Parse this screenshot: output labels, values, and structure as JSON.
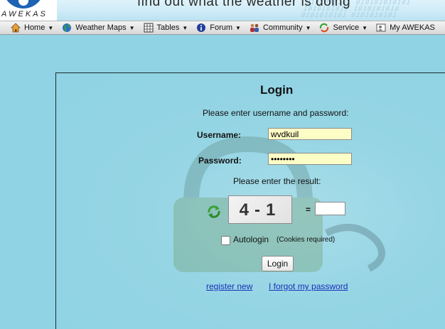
{
  "header": {
    "logo_text": "AWEKAS",
    "slogan": "find out what the weather is doing"
  },
  "nav": {
    "items": [
      {
        "label": "Home",
        "icon": "home-icon"
      },
      {
        "label": "Weather Maps",
        "icon": "globe-icon"
      },
      {
        "label": "Tables",
        "icon": "table-icon"
      },
      {
        "label": "Forum",
        "icon": "info-icon"
      },
      {
        "label": "Community",
        "icon": "people-icon"
      },
      {
        "label": "Service",
        "icon": "service-icon"
      },
      {
        "label": "My AWEKAS",
        "icon": "my-awekas-icon"
      }
    ]
  },
  "login": {
    "title": "Login",
    "instructions": "Please enter username and password:",
    "username_label": "Username:",
    "username_value": "wvdkuil",
    "password_label": "Password:",
    "password_value": "wvdkuilx",
    "captcha_prompt": "Please enter the result:",
    "captcha_text": "4-1",
    "equals": "=",
    "captcha_answer": "",
    "autologin_label": "Autologin",
    "cookies_note": "(Cookies required)",
    "autologin_checked": false,
    "login_button": "Login",
    "register_link": "register new",
    "forgot_link": "I forgot my password"
  },
  "colors": {
    "background": "#8fd3e4",
    "input_highlight": "#fdfdc6",
    "link": "#1a2fb8"
  }
}
